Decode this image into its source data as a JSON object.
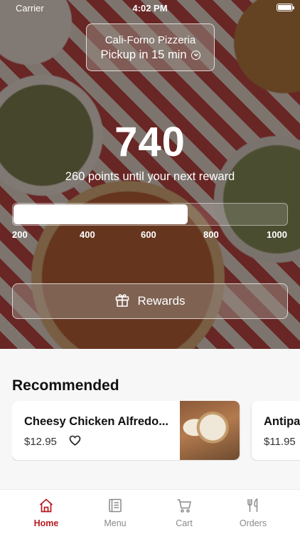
{
  "status_bar": {
    "carrier": "Carrier",
    "time": "4:02 PM"
  },
  "store": {
    "name": "Cali-Forno Pizzeria",
    "pickup": "Pickup in 15 min"
  },
  "rewards": {
    "points": "740",
    "subtitle": "260 points until your next reward",
    "progress_fraction": 0.64,
    "ticks": [
      "200",
      "400",
      "600",
      "800",
      "1000"
    ],
    "button_label": "Rewards"
  },
  "recommended": {
    "title": "Recommended",
    "items": [
      {
        "name": "Cheesy Chicken Alfredo...",
        "price": "$12.95"
      },
      {
        "name": "Antipa",
        "price": "$11.95"
      }
    ]
  },
  "tabs": [
    {
      "label": "Home",
      "icon": "home-icon",
      "active": true
    },
    {
      "label": "Menu",
      "icon": "menu-icon",
      "active": false
    },
    {
      "label": "Cart",
      "icon": "cart-icon",
      "active": false
    },
    {
      "label": "Orders",
      "icon": "fork-knife-icon",
      "active": false
    }
  ],
  "colors": {
    "accent": "#b7191f",
    "inactive": "#8a8a8a"
  }
}
